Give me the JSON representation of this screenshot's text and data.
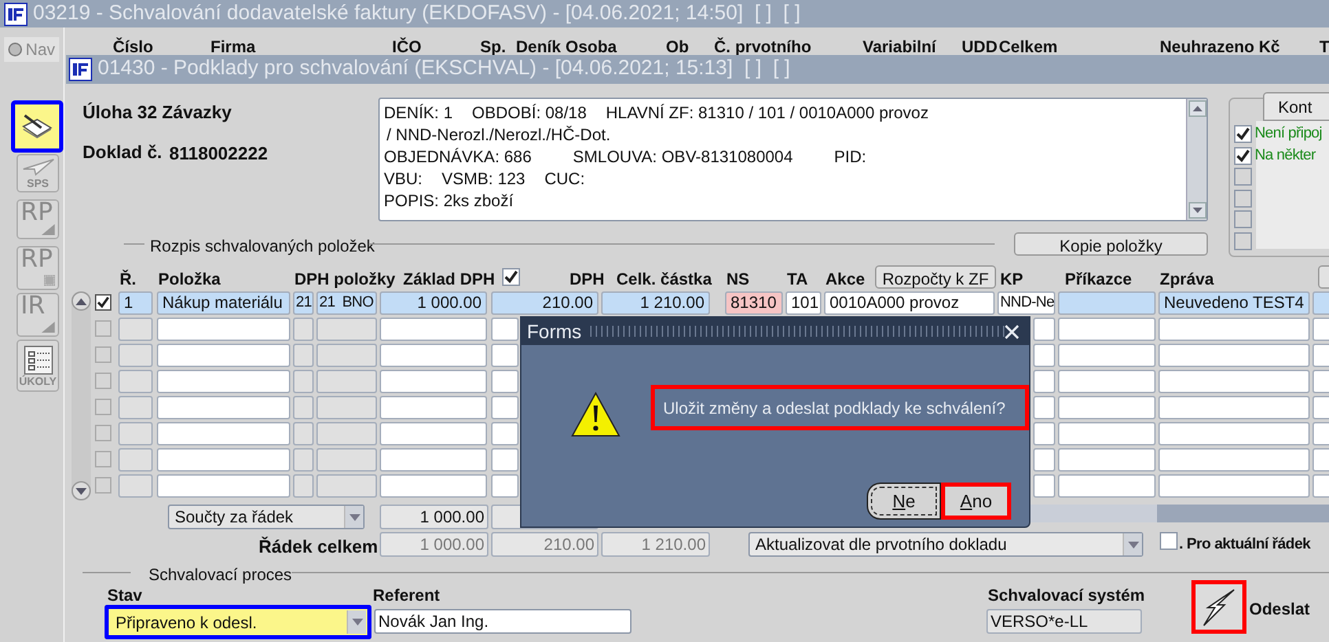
{
  "outer_window": {
    "title": "03219 - Schvalování dodavatelské faktury (EKDOFASV) - [04.06.2021; 14:50]  [ ]  [ ]",
    "nav": {
      "label": "Nav",
      "selected": false
    },
    "columns": [
      "Číslo",
      "Firma",
      "IČO",
      "Sp.",
      "Deník",
      "Osoba",
      "Ob",
      "Č. prvotního",
      "Variabilní",
      "UDD",
      "Celkem",
      "Neuhrazeno Kč",
      "T"
    ]
  },
  "toolbar": [
    {
      "kind": "edit",
      "focused": true
    },
    {
      "kind": "plane",
      "label": "SPS"
    },
    {
      "kind": "corner",
      "label": "RP"
    },
    {
      "kind": "dotted",
      "label": "RP"
    },
    {
      "kind": "corner",
      "label": "IR"
    },
    {
      "kind": "list",
      "label": "ÚKOLY"
    }
  ],
  "window": {
    "title": "01430 - Podklady pro schvalování (EKSCHVAL) - [04.06.2021; 15:13]  [ ]  [ ]",
    "task": "Úloha 32 Závazky",
    "document_label": "Doklad č.",
    "document_number": "8118002222",
    "info_lines": [
      [
        "DENÍK: 1",
        "OBDOBÍ: 08/18",
        "HLAVNÍ ZF: 81310 / 101 / 0010A000 provoz"
      ],
      [
        "/ NND-Nerozl./Nerozl./HČ-Dot."
      ],
      [
        "OBJEDNÁVKA: 686",
        "SMLOUVA: OBV-8131080004",
        "PID:"
      ],
      [
        "VBU:",
        "VSMB: 123",
        "CUC:"
      ],
      [
        "POPIS: 2ks zboží"
      ]
    ],
    "side_panel": {
      "tab": "Kont",
      "checks": [
        {
          "label": "Není připoj",
          "checked": true
        },
        {
          "label": "Na někter",
          "checked": true
        },
        {
          "checked": false
        },
        {
          "checked": false
        },
        {
          "checked": false
        },
        {
          "checked": false
        }
      ]
    },
    "items": {
      "title": "Rozpis schvalovaných položek",
      "copy_button": "Kopie položky",
      "headers": {
        "r": "Ř.",
        "item": "Položka",
        "vat_item": "DPH položky",
        "base": "Základ DPH",
        "vat": "DPH",
        "total": "Celk. částka",
        "ns": "NS",
        "ta": "TA",
        "action": "Akce",
        "kp": "KP",
        "orderer": "Příkazce",
        "message": "Zpráva"
      },
      "header_check": true,
      "budget_button": "Rozpočty k ZF",
      "rows": [
        {
          "checked": true,
          "selected": true,
          "cells": {
            "r": "1",
            "item": "Nákup materiálu",
            "vat1": "21",
            "vat2": "21  BNO",
            "base": "1 000.00",
            "vat": "210.00",
            "total": "1 210.00",
            "ns": "81310",
            "ta": "101",
            "action": "0010A000 provoz",
            "kp": "NND-Ne",
            "message": "Neuvedeno TEST4"
          }
        },
        {
          "checked": false,
          "selected": false
        },
        {
          "checked": false,
          "selected": false
        },
        {
          "checked": false,
          "selected": false
        },
        {
          "checked": false,
          "selected": false
        },
        {
          "checked": false,
          "selected": false
        },
        {
          "checked": false,
          "selected": false
        },
        {
          "checked": false,
          "selected": false
        }
      ],
      "totals_select": "Součty za řádek",
      "totals_base": "1 000.00",
      "row_total_label": "Řádek celkem",
      "row_totals": [
        "1 000.00",
        "210.00",
        "1 210.00"
      ],
      "update_select": "Aktualizovat dle prvotního dokladu",
      "current_row": {
        "label": ". Pro aktuální řádek",
        "checked": false
      }
    },
    "approval": {
      "title": "Schvalovací proces",
      "status_label": "Stav",
      "status": "Připraveno k odesl.",
      "status_focused": true,
      "referent_label": "Referent",
      "referent": "Novák Jan Ing.",
      "system_label": "Schvalovací systém",
      "system": "VERSO*e-LL",
      "send_label": "Odeslat",
      "send_marked": true
    }
  },
  "dialog": {
    "title": "Forms",
    "message": "Uložit změny a odeslat podklady ke schválení?",
    "message_marked": true,
    "buttons": [
      {
        "label": "Ne",
        "selected": true
      },
      {
        "label": "Ano",
        "selected": false,
        "marked": true
      }
    ]
  }
}
